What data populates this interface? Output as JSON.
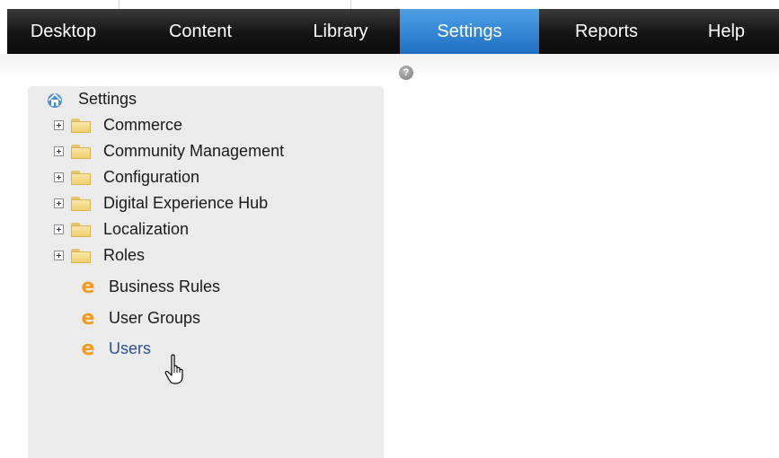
{
  "nav": {
    "tabs": [
      {
        "label": "Desktop"
      },
      {
        "label": "Content"
      },
      {
        "label": "Library"
      },
      {
        "label": "Settings",
        "active": true
      },
      {
        "label": "Reports"
      },
      {
        "label": "Help"
      }
    ],
    "active_color": "#2a7fd0"
  },
  "help_icon": {
    "glyph": "?",
    "icon": "help-icon"
  },
  "tree": {
    "root": {
      "label": "Settings",
      "icon": "home-icon"
    },
    "folders": [
      {
        "label": "Commerce",
        "icon": "folder-icon"
      },
      {
        "label": "Community Management",
        "icon": "folder-icon"
      },
      {
        "label": "Configuration",
        "icon": "folder-icon"
      },
      {
        "label": "Digital Experience Hub",
        "icon": "folder-icon"
      },
      {
        "label": "Localization",
        "icon": "folder-icon"
      },
      {
        "label": "Roles",
        "icon": "folder-icon"
      }
    ],
    "leaves": [
      {
        "label": "Business Rules",
        "icon": "e-icon",
        "glyph": "e"
      },
      {
        "label": "User Groups",
        "icon": "e-icon",
        "glyph": "e"
      },
      {
        "label": "Users",
        "icon": "e-icon",
        "glyph": "e",
        "hovered": true
      }
    ]
  }
}
